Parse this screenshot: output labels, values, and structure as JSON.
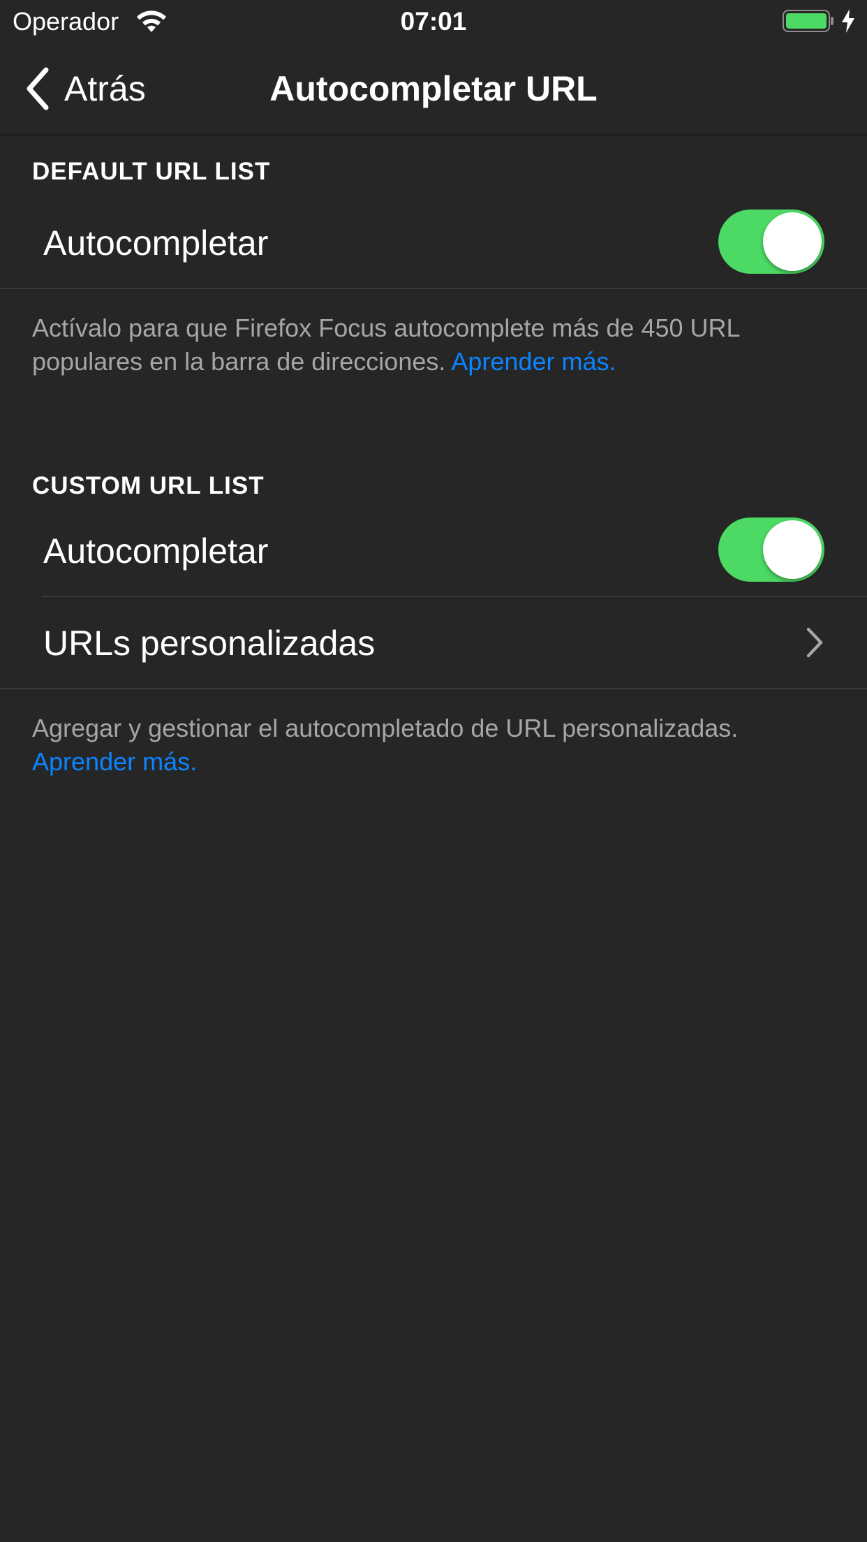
{
  "status_bar": {
    "carrier": "Operador",
    "time": "07:01",
    "battery_color": "#4cd964"
  },
  "nav": {
    "back_label": "Atrás",
    "title": "Autocompletar URL"
  },
  "sections": {
    "default": {
      "header": "DEFAULT URL LIST",
      "toggle_label": "Autocompletar",
      "toggle_on": true,
      "footer_text": "Actívalo para que Firefox Focus autocomplete más de 450 URL populares en la barra de direcciones.",
      "footer_link": "Aprender más."
    },
    "custom": {
      "header": "CUSTOM URL LIST",
      "toggle_label": "Autocompletar",
      "toggle_on": true,
      "row_label": "URLs personalizadas",
      "footer_text": "Agregar y gestionar el autocompletado de URL personalizadas.",
      "footer_link": "Aprender más."
    }
  },
  "colors": {
    "background": "#262626",
    "toggle_on": "#4cd964",
    "link": "#0a84ff",
    "secondary_text": "#a6a6a6"
  },
  "icons": {
    "wifi": "wifi-icon",
    "battery": "battery-icon",
    "charging": "charging-bolt-icon",
    "back": "chevron-left-icon",
    "disclosure": "chevron-right-icon"
  }
}
